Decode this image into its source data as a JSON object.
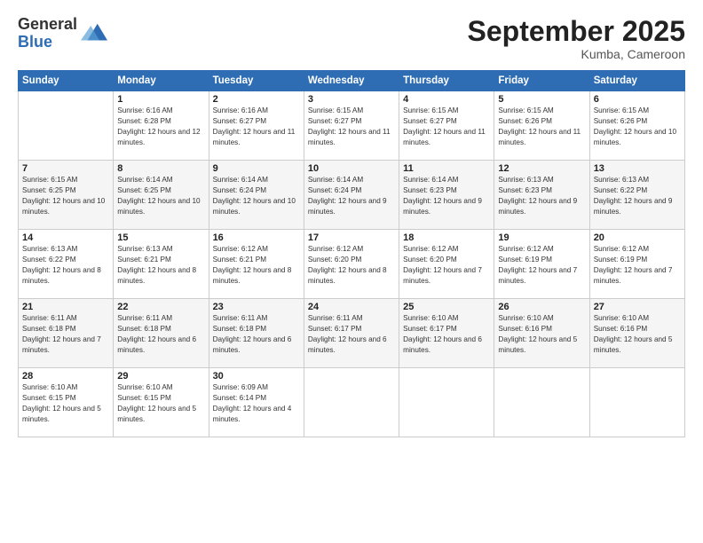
{
  "logo": {
    "general": "General",
    "blue": "Blue"
  },
  "header": {
    "title": "September 2025",
    "subtitle": "Kumba, Cameroon"
  },
  "days_header": [
    "Sunday",
    "Monday",
    "Tuesday",
    "Wednesday",
    "Thursday",
    "Friday",
    "Saturday"
  ],
  "weeks": [
    [
      {
        "num": "",
        "sunrise": "",
        "sunset": "",
        "daylight": ""
      },
      {
        "num": "1",
        "sunrise": "Sunrise: 6:16 AM",
        "sunset": "Sunset: 6:28 PM",
        "daylight": "Daylight: 12 hours and 12 minutes."
      },
      {
        "num": "2",
        "sunrise": "Sunrise: 6:16 AM",
        "sunset": "Sunset: 6:27 PM",
        "daylight": "Daylight: 12 hours and 11 minutes."
      },
      {
        "num": "3",
        "sunrise": "Sunrise: 6:15 AM",
        "sunset": "Sunset: 6:27 PM",
        "daylight": "Daylight: 12 hours and 11 minutes."
      },
      {
        "num": "4",
        "sunrise": "Sunrise: 6:15 AM",
        "sunset": "Sunset: 6:27 PM",
        "daylight": "Daylight: 12 hours and 11 minutes."
      },
      {
        "num": "5",
        "sunrise": "Sunrise: 6:15 AM",
        "sunset": "Sunset: 6:26 PM",
        "daylight": "Daylight: 12 hours and 11 minutes."
      },
      {
        "num": "6",
        "sunrise": "Sunrise: 6:15 AM",
        "sunset": "Sunset: 6:26 PM",
        "daylight": "Daylight: 12 hours and 10 minutes."
      }
    ],
    [
      {
        "num": "7",
        "sunrise": "Sunrise: 6:15 AM",
        "sunset": "Sunset: 6:25 PM",
        "daylight": "Daylight: 12 hours and 10 minutes."
      },
      {
        "num": "8",
        "sunrise": "Sunrise: 6:14 AM",
        "sunset": "Sunset: 6:25 PM",
        "daylight": "Daylight: 12 hours and 10 minutes."
      },
      {
        "num": "9",
        "sunrise": "Sunrise: 6:14 AM",
        "sunset": "Sunset: 6:24 PM",
        "daylight": "Daylight: 12 hours and 10 minutes."
      },
      {
        "num": "10",
        "sunrise": "Sunrise: 6:14 AM",
        "sunset": "Sunset: 6:24 PM",
        "daylight": "Daylight: 12 hours and 9 minutes."
      },
      {
        "num": "11",
        "sunrise": "Sunrise: 6:14 AM",
        "sunset": "Sunset: 6:23 PM",
        "daylight": "Daylight: 12 hours and 9 minutes."
      },
      {
        "num": "12",
        "sunrise": "Sunrise: 6:13 AM",
        "sunset": "Sunset: 6:23 PM",
        "daylight": "Daylight: 12 hours and 9 minutes."
      },
      {
        "num": "13",
        "sunrise": "Sunrise: 6:13 AM",
        "sunset": "Sunset: 6:22 PM",
        "daylight": "Daylight: 12 hours and 9 minutes."
      }
    ],
    [
      {
        "num": "14",
        "sunrise": "Sunrise: 6:13 AM",
        "sunset": "Sunset: 6:22 PM",
        "daylight": "Daylight: 12 hours and 8 minutes."
      },
      {
        "num": "15",
        "sunrise": "Sunrise: 6:13 AM",
        "sunset": "Sunset: 6:21 PM",
        "daylight": "Daylight: 12 hours and 8 minutes."
      },
      {
        "num": "16",
        "sunrise": "Sunrise: 6:12 AM",
        "sunset": "Sunset: 6:21 PM",
        "daylight": "Daylight: 12 hours and 8 minutes."
      },
      {
        "num": "17",
        "sunrise": "Sunrise: 6:12 AM",
        "sunset": "Sunset: 6:20 PM",
        "daylight": "Daylight: 12 hours and 8 minutes."
      },
      {
        "num": "18",
        "sunrise": "Sunrise: 6:12 AM",
        "sunset": "Sunset: 6:20 PM",
        "daylight": "Daylight: 12 hours and 7 minutes."
      },
      {
        "num": "19",
        "sunrise": "Sunrise: 6:12 AM",
        "sunset": "Sunset: 6:19 PM",
        "daylight": "Daylight: 12 hours and 7 minutes."
      },
      {
        "num": "20",
        "sunrise": "Sunrise: 6:12 AM",
        "sunset": "Sunset: 6:19 PM",
        "daylight": "Daylight: 12 hours and 7 minutes."
      }
    ],
    [
      {
        "num": "21",
        "sunrise": "Sunrise: 6:11 AM",
        "sunset": "Sunset: 6:18 PM",
        "daylight": "Daylight: 12 hours and 7 minutes."
      },
      {
        "num": "22",
        "sunrise": "Sunrise: 6:11 AM",
        "sunset": "Sunset: 6:18 PM",
        "daylight": "Daylight: 12 hours and 6 minutes."
      },
      {
        "num": "23",
        "sunrise": "Sunrise: 6:11 AM",
        "sunset": "Sunset: 6:18 PM",
        "daylight": "Daylight: 12 hours and 6 minutes."
      },
      {
        "num": "24",
        "sunrise": "Sunrise: 6:11 AM",
        "sunset": "Sunset: 6:17 PM",
        "daylight": "Daylight: 12 hours and 6 minutes."
      },
      {
        "num": "25",
        "sunrise": "Sunrise: 6:10 AM",
        "sunset": "Sunset: 6:17 PM",
        "daylight": "Daylight: 12 hours and 6 minutes."
      },
      {
        "num": "26",
        "sunrise": "Sunrise: 6:10 AM",
        "sunset": "Sunset: 6:16 PM",
        "daylight": "Daylight: 12 hours and 5 minutes."
      },
      {
        "num": "27",
        "sunrise": "Sunrise: 6:10 AM",
        "sunset": "Sunset: 6:16 PM",
        "daylight": "Daylight: 12 hours and 5 minutes."
      }
    ],
    [
      {
        "num": "28",
        "sunrise": "Sunrise: 6:10 AM",
        "sunset": "Sunset: 6:15 PM",
        "daylight": "Daylight: 12 hours and 5 minutes."
      },
      {
        "num": "29",
        "sunrise": "Sunrise: 6:10 AM",
        "sunset": "Sunset: 6:15 PM",
        "daylight": "Daylight: 12 hours and 5 minutes."
      },
      {
        "num": "30",
        "sunrise": "Sunrise: 6:09 AM",
        "sunset": "Sunset: 6:14 PM",
        "daylight": "Daylight: 12 hours and 4 minutes."
      },
      {
        "num": "",
        "sunrise": "",
        "sunset": "",
        "daylight": ""
      },
      {
        "num": "",
        "sunrise": "",
        "sunset": "",
        "daylight": ""
      },
      {
        "num": "",
        "sunrise": "",
        "sunset": "",
        "daylight": ""
      },
      {
        "num": "",
        "sunrise": "",
        "sunset": "",
        "daylight": ""
      }
    ]
  ]
}
